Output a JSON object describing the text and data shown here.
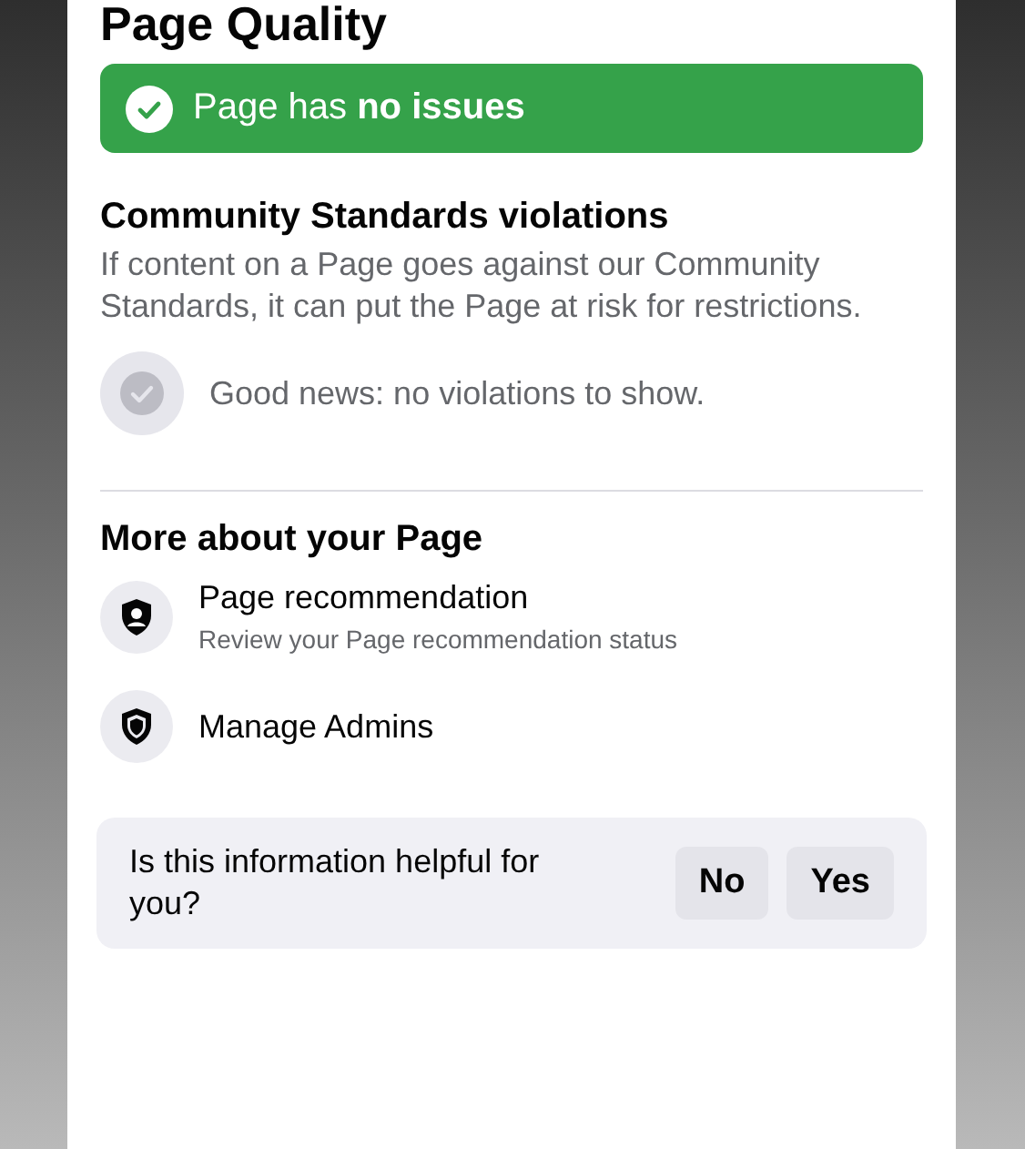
{
  "title": "Page Quality",
  "status_banner": {
    "text": "Page has **no issues**"
  },
  "violations": {
    "heading": "Community Standards violations",
    "description": "If content on a Page goes against our Community Standards, it can put the Page at risk for restrictions.",
    "empty_state": "Good news: no violations to show."
  },
  "more": {
    "heading": "More about your Page",
    "items": [
      {
        "kind": "person-shield",
        "title": "Page recommendation",
        "subtitle": "Review your Page recommendation status"
      },
      {
        "kind": "shield",
        "title": "Manage Admins"
      }
    ]
  },
  "feedback": {
    "question": "Is this information helpful for you?",
    "buttons": [
      "No",
      "Yes"
    ]
  }
}
